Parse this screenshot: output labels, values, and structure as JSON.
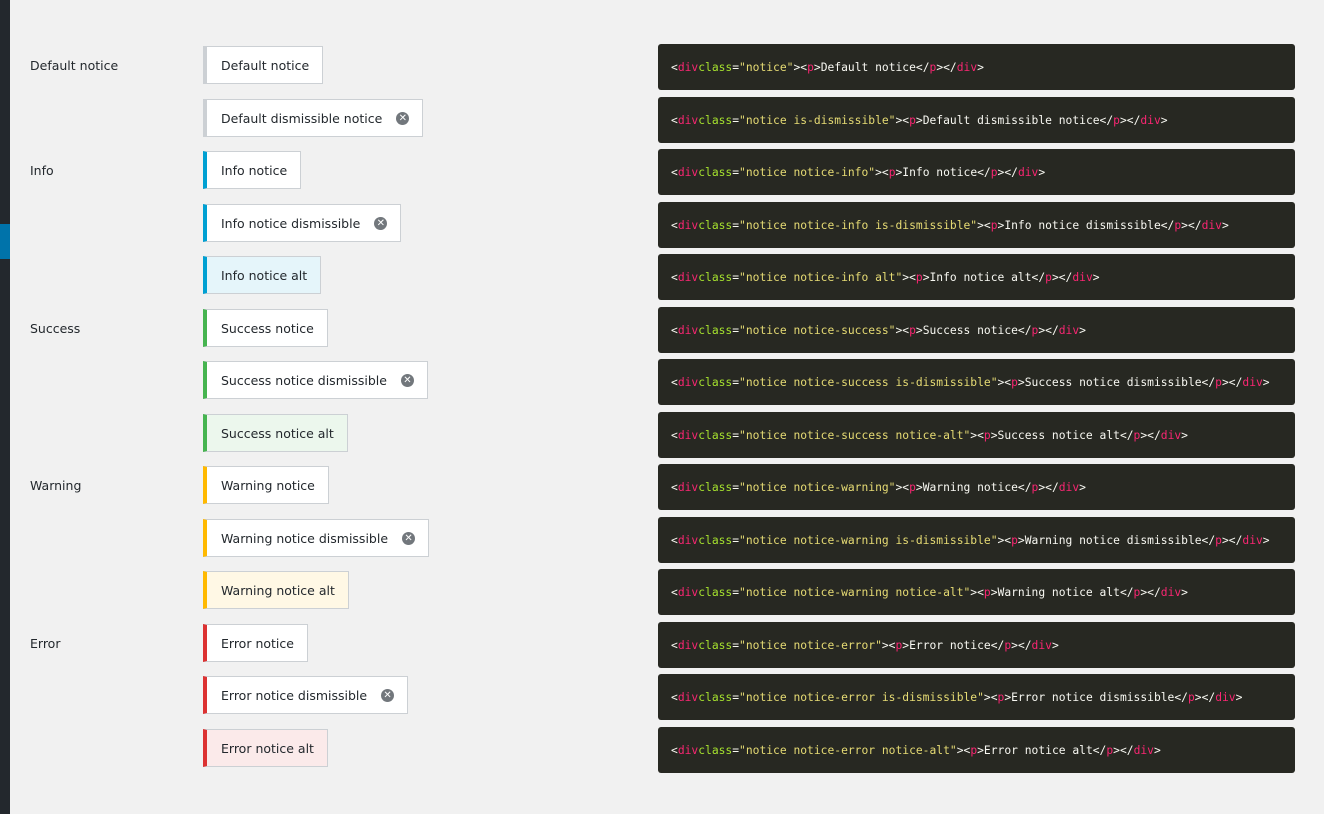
{
  "colors": {
    "default": {
      "border": "#ccd0d4",
      "bg": "#ffffff"
    },
    "info": {
      "border": "#00a0d2",
      "alt_bg": "#e5f5fa"
    },
    "success": {
      "border": "#46b450",
      "alt_bg": "#ecf7ed"
    },
    "warning": {
      "border": "#ffb900",
      "alt_bg": "#fff8e5"
    },
    "error": {
      "border": "#dc3232",
      "alt_bg": "#fbeaea"
    }
  },
  "sections": [
    {
      "label": "Default notice",
      "row": 0
    },
    {
      "label": "Info",
      "row": 2
    },
    {
      "label": "Success",
      "row": 5
    },
    {
      "label": "Warning",
      "row": 8
    },
    {
      "label": "Error",
      "row": 11
    }
  ],
  "rows": [
    {
      "text": "Default notice",
      "type": "default",
      "dismissible": false,
      "alt": false,
      "classes": "notice"
    },
    {
      "text": "Default dismissible notice",
      "type": "default",
      "dismissible": true,
      "alt": false,
      "classes": "notice is-dismissible"
    },
    {
      "text": "Info notice",
      "type": "info",
      "dismissible": false,
      "alt": false,
      "classes": "notice notice-info"
    },
    {
      "text": "Info notice dismissible",
      "type": "info",
      "dismissible": true,
      "alt": false,
      "classes": "notice notice-info is-dismissible"
    },
    {
      "text": "Info notice alt",
      "type": "info",
      "dismissible": false,
      "alt": true,
      "classes": "notice notice-info alt"
    },
    {
      "text": "Success notice",
      "type": "success",
      "dismissible": false,
      "alt": false,
      "classes": "notice notice-success"
    },
    {
      "text": "Success notice dismissible",
      "type": "success",
      "dismissible": true,
      "alt": false,
      "classes": "notice notice-success is-dismissible"
    },
    {
      "text": "Success notice alt",
      "type": "success",
      "dismissible": false,
      "alt": true,
      "classes": "notice notice-success notice-alt"
    },
    {
      "text": "Warning notice",
      "type": "warning",
      "dismissible": false,
      "alt": false,
      "classes": "notice notice-warning"
    },
    {
      "text": "Warning notice dismissible",
      "type": "warning",
      "dismissible": true,
      "alt": false,
      "classes": "notice notice-warning is-dismissible"
    },
    {
      "text": "Warning notice alt",
      "type": "warning",
      "dismissible": false,
      "alt": true,
      "classes": "notice notice-warning notice-alt"
    },
    {
      "text": "Error notice",
      "type": "error",
      "dismissible": false,
      "alt": false,
      "classes": "notice notice-error"
    },
    {
      "text": "Error notice dismissible",
      "type": "error",
      "dismissible": true,
      "alt": false,
      "classes": "notice notice-error is-dismissible"
    },
    {
      "text": "Error notice alt",
      "type": "error",
      "dismissible": false,
      "alt": true,
      "classes": "notice notice-error notice-alt"
    }
  ],
  "code_tokens": {
    "tag": "div",
    "attr": "class",
    "p": "p"
  },
  "dismiss_icon": "dismiss-icon"
}
